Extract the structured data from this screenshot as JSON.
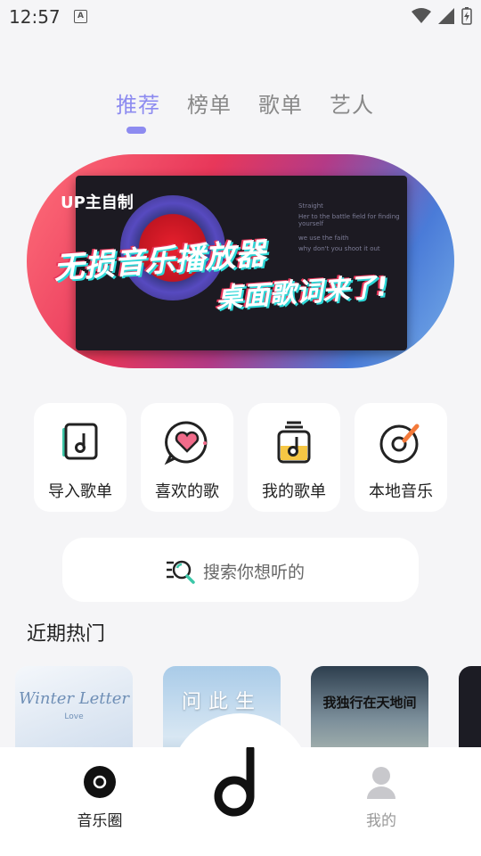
{
  "status_bar": {
    "time": "12:57",
    "a_glyph": "A"
  },
  "tabs": [
    {
      "label": "推荐",
      "active": true
    },
    {
      "label": "榜单",
      "active": false
    },
    {
      "label": "歌单",
      "active": false
    },
    {
      "label": "艺人",
      "active": false
    }
  ],
  "banner": {
    "tag": "UP主自制",
    "headline": "无损音乐播放器",
    "subheadline": "桌面歌词来了!",
    "lyrics": [
      "Straight",
      "Her to the battle field for finding yourself",
      "we use the faith",
      "why don't you shoot it out"
    ]
  },
  "shortcuts": [
    {
      "label": "导入歌单",
      "icon": "import-playlist-icon"
    },
    {
      "label": "喜欢的歌",
      "icon": "favorite-songs-icon"
    },
    {
      "label": "我的歌单",
      "icon": "my-playlist-icon"
    },
    {
      "label": "本地音乐",
      "icon": "local-music-icon"
    }
  ],
  "search": {
    "placeholder": "搜索你想听的"
  },
  "recent": {
    "title": "近期热门",
    "items": [
      {
        "cover_text": "Winter Letter",
        "cover_sub": "Love"
      },
      {
        "cover_text": "问此生",
        "cover_sub": ""
      },
      {
        "cover_text": "我独行在天地间",
        "cover_sub": ""
      },
      {
        "cover_text": "",
        "cover_sub": ""
      }
    ]
  },
  "bottom_nav": {
    "left_label": "音乐圈",
    "right_label": "我的"
  },
  "colors": {
    "accent": "#8d8bf0",
    "background": "#f5f5f7"
  }
}
